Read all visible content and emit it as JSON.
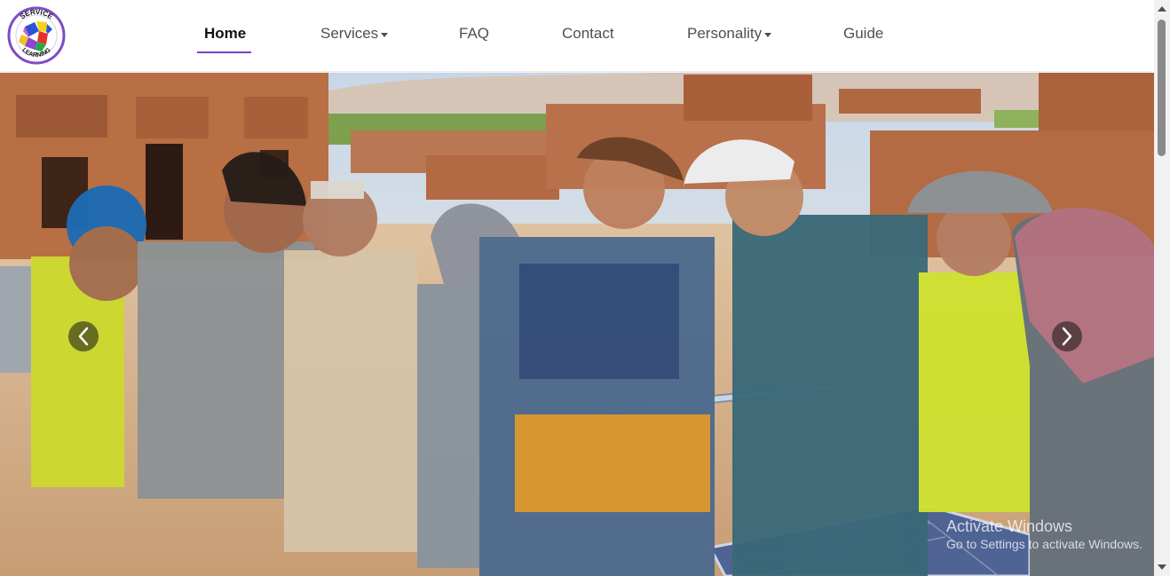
{
  "logo": {
    "text_top": "SERVICE",
    "text_bottom": "LEARNING",
    "colors": {
      "ring": "#7e4cc8",
      "piece_blue": "#2b52d8",
      "piece_yellow": "#f3d317",
      "piece_red": "#e5322c",
      "piece_green": "#28a745",
      "piece_purple": "#8a46d3"
    }
  },
  "nav": {
    "items": [
      {
        "label": "Home",
        "active": true,
        "dropdown": false
      },
      {
        "label": "Services",
        "active": false,
        "dropdown": true
      },
      {
        "label": "FAQ",
        "active": false,
        "dropdown": false
      },
      {
        "label": "Contact",
        "active": false,
        "dropdown": false
      },
      {
        "label": "Personality",
        "active": false,
        "dropdown": true
      },
      {
        "label": "Guide",
        "active": false,
        "dropdown": false
      }
    ],
    "active_underline_color": "#7b3fd6"
  },
  "hero": {
    "carousel": {
      "prev_icon": "chevron-left-icon",
      "next_icon": "chevron-right-icon"
    }
  },
  "watermark": {
    "title": "Activate Windows",
    "subtitle": "Go to Settings to activate Windows."
  },
  "scrollbar": {
    "up_icon": "chevron-up-icon",
    "down_icon": "chevron-down-icon"
  }
}
